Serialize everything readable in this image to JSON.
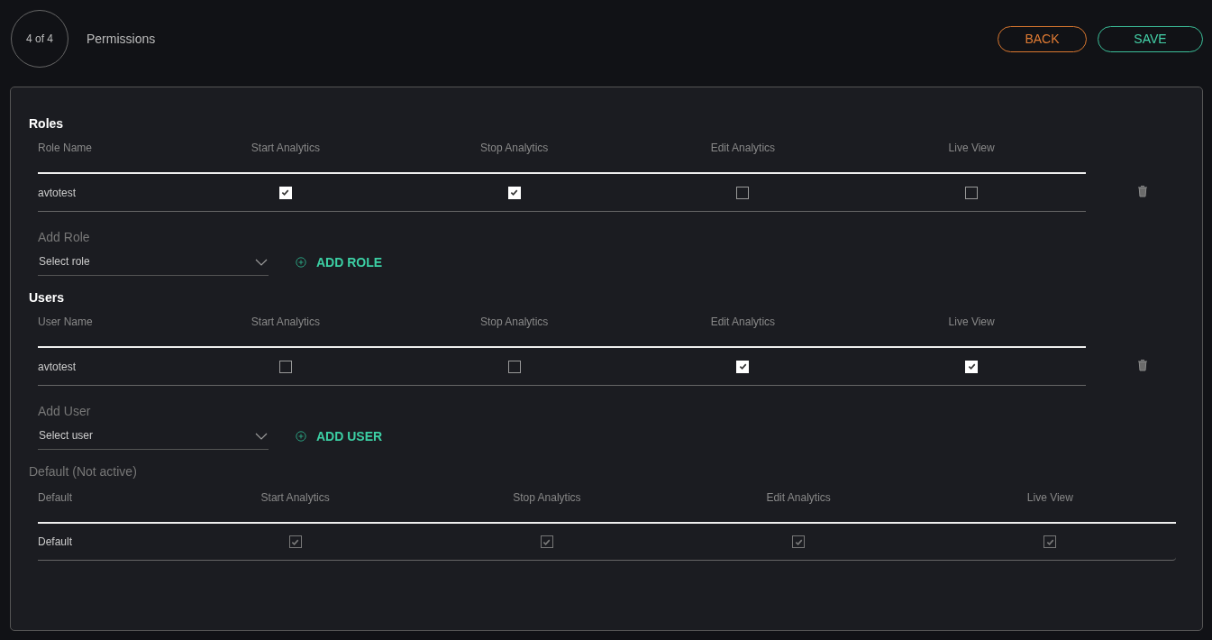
{
  "header": {
    "step": "4 of 4",
    "title": "Permissions",
    "buttons": [
      {
        "label": "BACK",
        "kind": "back"
      },
      {
        "label": "SAVE",
        "kind": "save"
      }
    ]
  },
  "sections": [
    {
      "title": "Roles",
      "columns": [
        "Role Name",
        "Start Analytics",
        "Stop Analytics",
        "Edit Analytics",
        "Live View"
      ],
      "rows": [
        {
          "name": "avtotest",
          "permissions": [
            {
              "checked": true
            },
            {
              "checked": true
            },
            {
              "checked": false
            },
            {
              "checked": false
            }
          ]
        }
      ],
      "add": {
        "label": "Add Role",
        "placeholder": "Select role",
        "button": "ADD ROLE"
      }
    },
    {
      "title": "Users",
      "columns": [
        "User Name",
        "Start Analytics",
        "Stop Analytics",
        "Edit Analytics",
        "Live View"
      ],
      "rows": [
        {
          "name": "avtotest",
          "permissions": [
            {
              "checked": false
            },
            {
              "checked": false
            },
            {
              "checked": true
            },
            {
              "checked": true
            }
          ]
        }
      ],
      "add": {
        "label": "Add User",
        "placeholder": "Select user",
        "button": "ADD USER"
      }
    }
  ],
  "default": {
    "title": "Default (Not active)",
    "columns": [
      "Default",
      "Start Analytics",
      "Stop Analytics",
      "Edit Analytics",
      "Live View"
    ],
    "rows": [
      {
        "name": "Default",
        "permissions": [
          {
            "checked": true,
            "disabled": true
          },
          {
            "checked": true,
            "disabled": true
          },
          {
            "checked": true,
            "disabled": true
          },
          {
            "checked": true,
            "disabled": true
          }
        ]
      }
    ]
  }
}
